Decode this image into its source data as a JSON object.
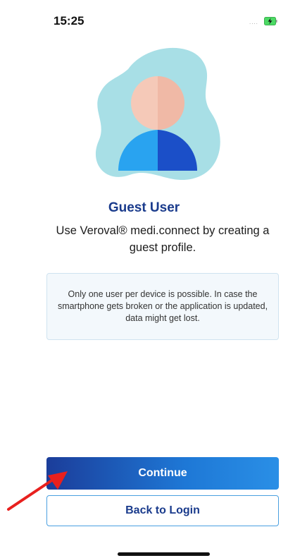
{
  "status_bar": {
    "time": "15:25",
    "signal": "....",
    "battery_icon": "battery-charging-icon"
  },
  "illustration": {
    "icon": "guest-user-avatar-icon",
    "colors": {
      "blob": "#a8dfe6",
      "face_left": "#f5c9b8",
      "face_right": "#f0b9a6",
      "body_left": "#29a3f0",
      "body_right": "#1b4fc8"
    }
  },
  "title": "Guest User",
  "subtitle": "Use Veroval® medi.connect by creating a guest profile.",
  "info_box": {
    "text": "Only one user per device is possible. In case the smartphone gets broken or the application is updated, data might get lost."
  },
  "buttons": {
    "continue_label": "Continue",
    "back_label": "Back to Login"
  },
  "colors": {
    "accent": "#1a3b8c",
    "button_gradient_start": "#1b3d9a",
    "button_gradient_end": "#2a8fe6",
    "outline": "#4aa0e0",
    "annotation_arrow": "#e8201e"
  }
}
